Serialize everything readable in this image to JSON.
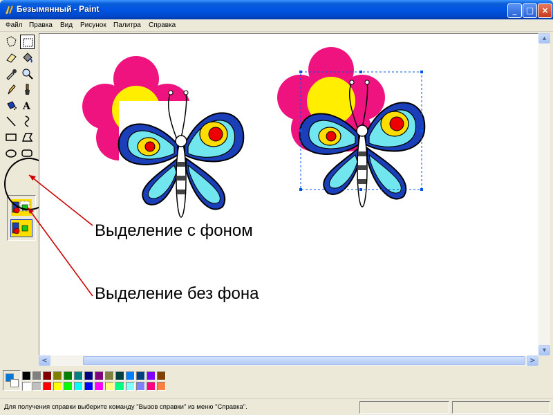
{
  "window": {
    "title": "Безымянный - Paint",
    "controls": {
      "minimize": "_",
      "maximize": "□",
      "close": "×"
    }
  },
  "menu": [
    "Файл",
    "Правка",
    "Вид",
    "Рисунок",
    "Палитра",
    "Справка"
  ],
  "toolbox": {
    "tools": [
      "free-form-select",
      "rectangle-select",
      "eraser",
      "fill",
      "color-picker",
      "magnifier",
      "pencil",
      "brush",
      "airbrush",
      "text",
      "line",
      "curve",
      "rectangle",
      "polygon",
      "ellipse",
      "rounded-rectangle"
    ],
    "active_tool": "rectangle-select",
    "text_tool_glyph": "A",
    "options": [
      "opaque-selection",
      "transparent-selection"
    ],
    "active_option": "transparent-selection"
  },
  "annotations": {
    "with_background": "Выделение с фоном",
    "without_background": "Выделение без фона",
    "arrow_color": "#cc0000"
  },
  "palette": {
    "foreground": "#0078d7",
    "background": "#ffffff",
    "row1": [
      "#000000",
      "#808080",
      "#800000",
      "#808000",
      "#008000",
      "#008080",
      "#000080",
      "#800080",
      "#808040",
      "#004040",
      "#0080ff",
      "#004080",
      "#8000ff",
      "#804000"
    ],
    "row2": [
      "#ffffff",
      "#c0c0c0",
      "#ff0000",
      "#ffff00",
      "#00ff00",
      "#00ffff",
      "#0000ff",
      "#ff00ff",
      "#ffff80",
      "#00ff80",
      "#80ffff",
      "#8080ff",
      "#ff0080",
      "#ff8040"
    ]
  },
  "scrollbars": {
    "left_arrow": "<",
    "right_arrow": ">",
    "up_arrow": "▴",
    "down_arrow": "▾"
  },
  "status": {
    "text": "Для получения справки выберите команду \"Вызов справки\" из меню \"Справка\"."
  }
}
